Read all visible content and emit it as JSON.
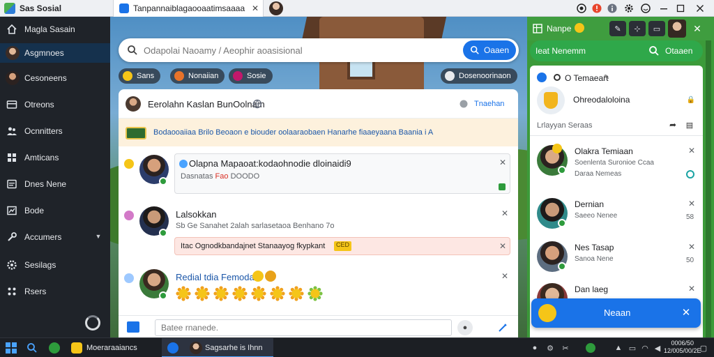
{
  "titlebar": {
    "app_title": "Sas Sosial",
    "active_tab_title": "Tanpannaiblagaooaatimsaaaa",
    "controls": [
      "record-icon",
      "alert-icon",
      "info-icon",
      "settings-icon",
      "minimize-icon",
      "maximize-icon",
      "close-icon"
    ]
  },
  "sidebar": {
    "items": [
      {
        "label": "Magla Sasain",
        "icon": "home-icon"
      },
      {
        "label": "Asgmnoes",
        "icon": "avatar",
        "active": true
      },
      {
        "label": "Cesoneens",
        "icon": "avatar"
      },
      {
        "label": "Otreons",
        "icon": "card-icon"
      },
      {
        "label": "Ocnnitters",
        "icon": "users-icon"
      },
      {
        "label": "Amticans",
        "icon": "grid-icon"
      },
      {
        "label": "Dnes Nene",
        "icon": "list-icon"
      },
      {
        "label": "Bode",
        "icon": "chart-icon"
      },
      {
        "label": "Accumers",
        "icon": "tool-icon",
        "chevron": true
      },
      {
        "label": "Sesilags",
        "icon": "settings-icon"
      },
      {
        "label": "Rsers",
        "icon": "apps-icon"
      }
    ]
  },
  "search": {
    "placeholder": "Odapolai Naoamy / Aeophir aoasisional",
    "button_label": "Oaaen"
  },
  "chips": [
    {
      "label": "Sans",
      "color": "#f5c518"
    },
    {
      "label": "Nonaiian",
      "color": "#e8732a"
    },
    {
      "label": "Sosie",
      "color": "#c2186b"
    }
  ],
  "scene_chip": {
    "label": "Dosenoorinaon"
  },
  "feed": {
    "header_title": "Eerolahn Kaslan BunOolnam",
    "header_link": "Tnaehan",
    "notice_text": "Bodaooaiiaa Brilo Beoaon e biouder oolaaraobaen Hanarhe fiaaeyaana Baania i A",
    "posts": [
      {
        "name": "Olapna Mapaoat:kodaohnodie dloinaidi9",
        "meta_label": "Dasnatas",
        "meta_highlight": "Fao",
        "meta_value": "DOODO",
        "mini_color": "#f5c518",
        "avatar_skin": "#d6a07c",
        "avatar_hair": "#2b2220",
        "avatar_shirt": "#2c3d6b"
      },
      {
        "name": "Lalsokkan",
        "meta": "Sb  Ge Sanahet 2alah  sarlasetaoa Benhano 7o",
        "highlight_text": "Itac Ognodkbandajnet Stanaayog fkypkant",
        "highlight_badge": "CED",
        "mini_color": "#d37ac8",
        "avatar_skin": "#c99a79",
        "avatar_hair": "#1d1a1a",
        "avatar_shirt": "#24304f"
      },
      {
        "name": "Redial tdia Femodae",
        "mini_color": "#4aa3ff",
        "avatar_skin": "#d9a986",
        "avatar_hair": "#3a2a20",
        "avatar_shirt": "#3a7a3a",
        "reactions": [
          "sun",
          "sun",
          "sun",
          "sun",
          "sun",
          "sun",
          "sun",
          "sun"
        ]
      }
    ]
  },
  "composer": {
    "placeholder": "Batee rnanede."
  },
  "right_panel": {
    "header_title": "Nanpe",
    "bar_label": "Ieat Nenemm",
    "bar_action": "Otaaen",
    "top_title": "O Temaeart",
    "feature_title": "Ohreodaloloina",
    "section_label": "Lrlayyan Seraas",
    "contacts": [
      {
        "name": "Olakra Temiaan",
        "sub": "Soenlenta Suronioe Ccaa",
        "sub2": "Daraa Nemeas",
        "value": "",
        "skin": "#d9a986",
        "hair": "#2b2220"
      },
      {
        "name": "Dernian",
        "sub": "Saeeo Nenee",
        "value": "58",
        "skin": "#c99a79",
        "hair": "#1d1a1a"
      },
      {
        "name": "Nes Tasap",
        "sub": "Sanoa Nene",
        "value": "50",
        "skin": "#d6a07c",
        "hair": "#2b2220"
      },
      {
        "name": "Dan laeg",
        "sub": "",
        "value": "",
        "skin": "#e0b898",
        "hair": "#3a2a20"
      }
    ],
    "bottom_label": "Neaan"
  },
  "taskbar": {
    "app_label": "Moeraraaiancs",
    "active_label": "Sagsarhe is Ihnn",
    "time": "0006/50",
    "date": "12/005/00/2E"
  },
  "colors": {
    "accent": "#1a73e8",
    "green_panel": "#3c9b3a",
    "sidebar": "#1f2329",
    "notice": "#fdf1dd"
  }
}
